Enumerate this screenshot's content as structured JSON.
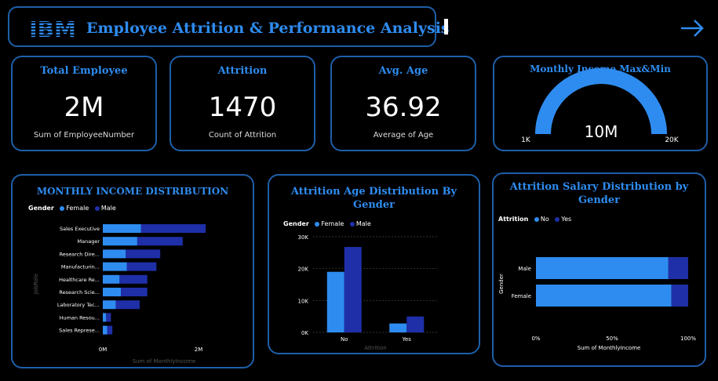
{
  "header": {
    "logo_text": "IBM",
    "title": "Employee Attrition & Performance Analysis"
  },
  "kpis": {
    "total_employee": {
      "title": "Total Employee",
      "value": "2M",
      "sub": "Sum of EmployeeNumber"
    },
    "attrition": {
      "title": "Attrition",
      "value": "1470",
      "sub": "Count of Attrition"
    },
    "avg_age": {
      "title": "Avg. Age",
      "value": "36.92",
      "sub": "Average of Age"
    }
  },
  "gauge": {
    "title": "Monthly Income Max&Min",
    "value_label": "10M",
    "min_label": "1K",
    "max_label": "20K",
    "fill_fraction": 1.0,
    "color": "#2e8cf0"
  },
  "colors": {
    "female": "#2e8cf0",
    "male": "#1f2fa8",
    "no": "#2e8cf0",
    "yes": "#1f2fa8",
    "accent": "#2e8cf0",
    "border": "#1e5fa8"
  },
  "chart_data": [
    {
      "type": "bar",
      "orientation": "horizontal",
      "stacked": true,
      "title": "MONTHLY INCOME DISTRIBUTION",
      "legend_title": "Gender",
      "legend_position": "top-left",
      "categories": [
        "Sales Executive",
        "Manager",
        "Research Dire...",
        "Manufacturin...",
        "Healthcare Re...",
        "Research Scie...",
        "Laboratory Tec...",
        "Human Resou...",
        "Sales Represe..."
      ],
      "series": [
        {
          "name": "Female",
          "values": [
            0.8,
            0.72,
            0.48,
            0.5,
            0.35,
            0.38,
            0.27,
            0.07,
            0.09
          ]
        },
        {
          "name": "Male",
          "values": [
            1.35,
            0.95,
            0.72,
            0.62,
            0.58,
            0.55,
            0.5,
            0.1,
            0.11
          ]
        }
      ],
      "xlim": [
        0,
        2
      ],
      "xticks": [
        "0M",
        "2M"
      ],
      "xlabel": "Sum of MonthlyIncome",
      "ylabel": "JobRole"
    },
    {
      "type": "bar",
      "title": "Attrition Age Distribution By Gender",
      "legend_title": "Gender",
      "legend_position": "top-left",
      "categories": [
        "No",
        "Yes"
      ],
      "series": [
        {
          "name": "Female",
          "values": [
            19000,
            2800
          ]
        },
        {
          "name": "Male",
          "values": [
            26800,
            5000
          ]
        }
      ],
      "ylim": [
        0,
        30000
      ],
      "yticks": [
        "0K",
        "10K",
        "20K",
        "30K"
      ],
      "xlabel": "Attrition",
      "grid": true
    },
    {
      "type": "bar",
      "orientation": "horizontal",
      "stacked": true,
      "percent": true,
      "title": "Attrition Salary Distribution by Gender",
      "legend_title": "Attrition",
      "legend_position": "top-left",
      "categories": [
        "Male",
        "Female"
      ],
      "series": [
        {
          "name": "No",
          "values": [
            87,
            89
          ]
        },
        {
          "name": "Yes",
          "values": [
            13,
            11
          ]
        }
      ],
      "xlim": [
        0,
        100
      ],
      "xticks": [
        "0%",
        "50%",
        "100%"
      ],
      "xlabel": "Sum of MonthlyIncome",
      "ylabel": "Gender"
    }
  ]
}
